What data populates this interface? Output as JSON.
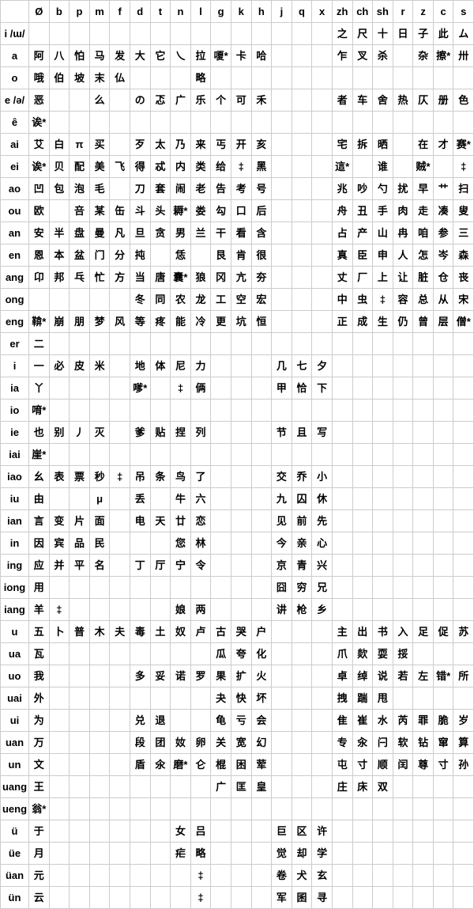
{
  "columns": [
    "",
    "Ø",
    "b",
    "p",
    "m",
    "f",
    "d",
    "t",
    "n",
    "l",
    "g",
    "k",
    "h",
    "j",
    "q",
    "x",
    "zh",
    "ch",
    "sh",
    "r",
    "z",
    "c",
    "s"
  ],
  "rows": [
    {
      "label": "i /ɯ/",
      "cells": [
        "",
        "",
        "",
        "",
        "",
        "",
        "",
        "",
        "",
        "",
        "",
        "",
        "",
        "",
        "",
        "之",
        "尺",
        "十",
        "日",
        "子",
        "此",
        "ム"
      ]
    },
    {
      "label": "a",
      "cells": [
        "阿",
        "八",
        "怕",
        "马",
        "发",
        "大",
        "它",
        "乀",
        "拉",
        "嗄*",
        "卡",
        "哈",
        "",
        "",
        "",
        "乍",
        "叉",
        "杀",
        "",
        "杂",
        "擦*",
        "卅"
      ]
    },
    {
      "label": "o",
      "cells": [
        "哦",
        "伯",
        "坡",
        "末",
        "仏",
        "",
        "",
        "",
        "略",
        "",
        "",
        "",
        "",
        "",
        "",
        "",
        "",
        "",
        "",
        "",
        "",
        ""
      ]
    },
    {
      "label": "e /ə/",
      "cells": [
        "恶",
        "",
        "",
        "么",
        "",
        "の",
        "忑",
        "广",
        "乐",
        "个",
        "可",
        "禾",
        "",
        "",
        "",
        "者",
        "车",
        "舍",
        "热",
        "仄",
        "册",
        "色"
      ]
    },
    {
      "label": "ê",
      "cells": [
        "诶*",
        "",
        "",
        "",
        "",
        "",
        "",
        "",
        "",
        "",
        "",
        "",
        "",
        "",
        "",
        "",
        "",
        "",
        "",
        "",
        "",
        ""
      ]
    },
    {
      "label": "ai",
      "cells": [
        "艾",
        "白",
        "π",
        "买",
        "",
        "歹",
        "太",
        "乃",
        "来",
        "丐",
        "开",
        "亥",
        "",
        "",
        "",
        "宅",
        "拆",
        "晒",
        "",
        "在",
        "才",
        "赛*"
      ]
    },
    {
      "label": "ei",
      "cells": [
        "诶*",
        "贝",
        "配",
        "美",
        "飞",
        "得",
        "忒",
        "内",
        "类",
        "给",
        "‡",
        "黑",
        "",
        "",
        "",
        "這*",
        "",
        "谁",
        "",
        "贼*",
        "",
        "‡"
      ]
    },
    {
      "label": "ao",
      "cells": [
        "凹",
        "包",
        "泡",
        "毛",
        "",
        "刀",
        "套",
        "闹",
        "老",
        "告",
        "考",
        "号",
        "",
        "",
        "",
        "兆",
        "吵",
        "勺",
        "扰",
        "早",
        "艹",
        "扫"
      ]
    },
    {
      "label": "ou",
      "cells": [
        "欧",
        "",
        "咅",
        "某",
        "缶",
        "斗",
        "头",
        "耨*",
        "娄",
        "勾",
        "口",
        "后",
        "",
        "",
        "",
        "舟",
        "丑",
        "手",
        "肉",
        "走",
        "凑",
        "叟"
      ]
    },
    {
      "label": "an",
      "cells": [
        "安",
        "半",
        "盘",
        "曼",
        "凡",
        "旦",
        "贪",
        "男",
        "兰",
        "干",
        "看",
        "含",
        "",
        "",
        "",
        "占",
        "产",
        "山",
        "冉",
        "咱",
        "参",
        "三"
      ]
    },
    {
      "label": "en",
      "cells": [
        "恩",
        "本",
        "盆",
        "门",
        "分",
        "扽",
        "",
        "恁",
        "",
        "艮",
        "肯",
        "很",
        "",
        "",
        "",
        "真",
        "臣",
        "申",
        "人",
        "怎",
        "岑",
        "森"
      ]
    },
    {
      "label": "ang",
      "cells": [
        "卬",
        "邦",
        "乓",
        "忙",
        "方",
        "当",
        "唐",
        "囊*",
        "狼",
        "冈",
        "亢",
        "夯",
        "",
        "",
        "",
        "丈",
        "厂",
        "上",
        "让",
        "脏",
        "仓",
        "丧"
      ]
    },
    {
      "label": "ong",
      "cells": [
        "",
        "",
        "",
        "",
        "",
        "冬",
        "同",
        "农",
        "龙",
        "工",
        "空",
        "宏",
        "",
        "",
        "",
        "中",
        "虫",
        "‡",
        "容",
        "总",
        "从",
        "宋"
      ]
    },
    {
      "label": "eng",
      "cells": [
        "鞥*",
        "崩",
        "朋",
        "梦",
        "风",
        "等",
        "疼",
        "能",
        "冷",
        "更",
        "坑",
        "恒",
        "",
        "",
        "",
        "正",
        "成",
        "生",
        "仍",
        "曾",
        "层",
        "僧*"
      ]
    },
    {
      "label": "er",
      "cells": [
        "二",
        "",
        "",
        "",
        "",
        "",
        "",
        "",
        "",
        "",
        "",
        "",
        "",
        "",
        "",
        "",
        "",
        "",
        "",
        "",
        "",
        ""
      ]
    },
    {
      "label": "i",
      "cells": [
        "一",
        "必",
        "皮",
        "米",
        "",
        "地",
        "体",
        "尼",
        "力",
        "",
        "",
        "",
        "几",
        "七",
        "夕",
        "",
        "",
        "",
        "",
        "",
        "",
        ""
      ]
    },
    {
      "label": "ia",
      "cells": [
        "丫",
        "",
        "",
        "",
        "",
        "嗲*",
        "",
        "‡",
        "俩",
        "",
        "",
        "",
        "甲",
        "恰",
        "下",
        "",
        "",
        "",
        "",
        "",
        "",
        ""
      ]
    },
    {
      "label": "io",
      "cells": [
        "唷*",
        "",
        "",
        "",
        "",
        "",
        "",
        "",
        "",
        "",
        "",
        "",
        "",
        "",
        "",
        "",
        "",
        "",
        "",
        "",
        "",
        ""
      ]
    },
    {
      "label": "ie",
      "cells": [
        "也",
        "别",
        "丿",
        "灭",
        "",
        "爹",
        "贴",
        "捏",
        "列",
        "",
        "",
        "",
        "节",
        "且",
        "写",
        "",
        "",
        "",
        "",
        "",
        "",
        ""
      ]
    },
    {
      "label": "iai",
      "cells": [
        "崖*",
        "",
        "",
        "",
        "",
        "",
        "",
        "",
        "",
        "",
        "",
        "",
        "",
        "",
        "",
        "",
        "",
        "",
        "",
        "",
        "",
        ""
      ]
    },
    {
      "label": "iao",
      "cells": [
        "幺",
        "表",
        "票",
        "秒",
        "‡",
        "吊",
        "条",
        "鸟",
        "了",
        "",
        "",
        "",
        "交",
        "乔",
        "小",
        "",
        "",
        "",
        "",
        "",
        "",
        ""
      ]
    },
    {
      "label": "iu",
      "cells": [
        "由",
        "",
        "",
        "μ",
        "",
        "丢",
        "",
        "牛",
        "六",
        "",
        "",
        "",
        "九",
        "囚",
        "休",
        "",
        "",
        "",
        "",
        "",
        "",
        ""
      ]
    },
    {
      "label": "ian",
      "cells": [
        "言",
        "变",
        "片",
        "面",
        "",
        "电",
        "天",
        "廿",
        "恋",
        "",
        "",
        "",
        "见",
        "前",
        "先",
        "",
        "",
        "",
        "",
        "",
        "",
        ""
      ]
    },
    {
      "label": "in",
      "cells": [
        "因",
        "宾",
        "品",
        "民",
        "",
        "",
        "",
        "您",
        "林",
        "",
        "",
        "",
        "今",
        "亲",
        "心",
        "",
        "",
        "",
        "",
        "",
        "",
        ""
      ]
    },
    {
      "label": "ing",
      "cells": [
        "应",
        "并",
        "平",
        "名",
        "",
        "丁",
        "厅",
        "宁",
        "令",
        "",
        "",
        "",
        "京",
        "青",
        "兴",
        "",
        "",
        "",
        "",
        "",
        "",
        ""
      ]
    },
    {
      "label": "iong",
      "cells": [
        "用",
        "",
        "",
        "",
        "",
        "",
        "",
        "",
        "",
        "",
        "",
        "",
        "囧",
        "穷",
        "兄",
        "",
        "",
        "",
        "",
        "",
        "",
        ""
      ]
    },
    {
      "label": "iang",
      "cells": [
        "羊",
        "‡",
        "",
        "",
        "",
        "",
        "",
        "娘",
        "两",
        "",
        "",
        "",
        "讲",
        "枪",
        "乡",
        "",
        "",
        "",
        "",
        "",
        "",
        ""
      ]
    },
    {
      "label": "u",
      "cells": [
        "五",
        "卜",
        "普",
        "木",
        "夫",
        "毒",
        "土",
        "奴",
        "卢",
        "古",
        "哭",
        "户",
        "",
        "",
        "",
        "主",
        "出",
        "书",
        "入",
        "足",
        "促",
        "苏"
      ]
    },
    {
      "label": "ua",
      "cells": [
        "瓦",
        "",
        "",
        "",
        "",
        "",
        "",
        "",
        "",
        "瓜",
        "夸",
        "化",
        "",
        "",
        "",
        "爪",
        "欻",
        "耍",
        "挼",
        "",
        "",
        ""
      ]
    },
    {
      "label": "uo",
      "cells": [
        "我",
        "",
        "",
        "",
        "",
        "多",
        "妥",
        "诺",
        "罗",
        "果",
        "扩",
        "火",
        "",
        "",
        "",
        "卓",
        "绰",
        "说",
        "若",
        "左",
        "错*",
        "所"
      ]
    },
    {
      "label": "uai",
      "cells": [
        "外",
        "",
        "",
        "",
        "",
        "",
        "",
        "",
        "",
        "夬",
        "快",
        "坏",
        "",
        "",
        "",
        "拽",
        "踹",
        "甩",
        "",
        "",
        "",
        ""
      ]
    },
    {
      "label": "ui",
      "cells": [
        "为",
        "",
        "",
        "",
        "",
        "兑",
        "退",
        "",
        "",
        "龟",
        "亏",
        "会",
        "",
        "",
        "",
        "隹",
        "崔",
        "水",
        "芮",
        "罪",
        "脆",
        "岁"
      ]
    },
    {
      "label": "uan",
      "cells": [
        "万",
        "",
        "",
        "",
        "",
        "段",
        "团",
        "奻",
        "卵",
        "关",
        "宽",
        "幻",
        "",
        "",
        "",
        "专",
        "汆",
        "闩",
        "软",
        "钻",
        "窜",
        "算"
      ]
    },
    {
      "label": "un",
      "cells": [
        "文",
        "",
        "",
        "",
        "",
        "盾",
        "氽",
        "磨*",
        "仑",
        "棍",
        "困",
        "荤",
        "",
        "",
        "",
        "屯",
        "寸",
        "顺",
        "闰",
        "尊",
        "寸",
        "孙"
      ]
    },
    {
      "label": "uang",
      "cells": [
        "王",
        "",
        "",
        "",
        "",
        "",
        "",
        "",
        "",
        "广",
        "匡",
        "皇",
        "",
        "",
        "",
        "庄",
        "床",
        "双",
        "",
        "",
        "",
        ""
      ]
    },
    {
      "label": "ueng",
      "cells": [
        "翁*",
        "",
        "",
        "",
        "",
        "",
        "",
        "",
        "",
        "",
        "",
        "",
        "",
        "",
        "",
        "",
        "",
        "",
        "",
        "",
        "",
        ""
      ]
    },
    {
      "label": "ü",
      "cells": [
        "于",
        "",
        "",
        "",
        "",
        "",
        "",
        "女",
        "吕",
        "",
        "",
        "",
        "巨",
        "区",
        "许",
        "",
        "",
        "",
        "",
        "",
        "",
        ""
      ]
    },
    {
      "label": "üe",
      "cells": [
        "月",
        "",
        "",
        "",
        "",
        "",
        "",
        "疟",
        "略",
        "",
        "",
        "",
        "觉",
        "却",
        "学",
        "",
        "",
        "",
        "",
        "",
        "",
        ""
      ]
    },
    {
      "label": "üan",
      "cells": [
        "元",
        "",
        "",
        "",
        "",
        "",
        "",
        "",
        "‡",
        "",
        "",
        "",
        "卷",
        "犬",
        "玄",
        "",
        "",
        "",
        "",
        "",
        "",
        ""
      ]
    },
    {
      "label": "ün",
      "cells": [
        "云",
        "",
        "",
        "",
        "",
        "",
        "",
        "",
        "‡",
        "",
        "",
        "",
        "军",
        "囷",
        "寻",
        "",
        "",
        "",
        "",
        "",
        "",
        ""
      ]
    }
  ]
}
